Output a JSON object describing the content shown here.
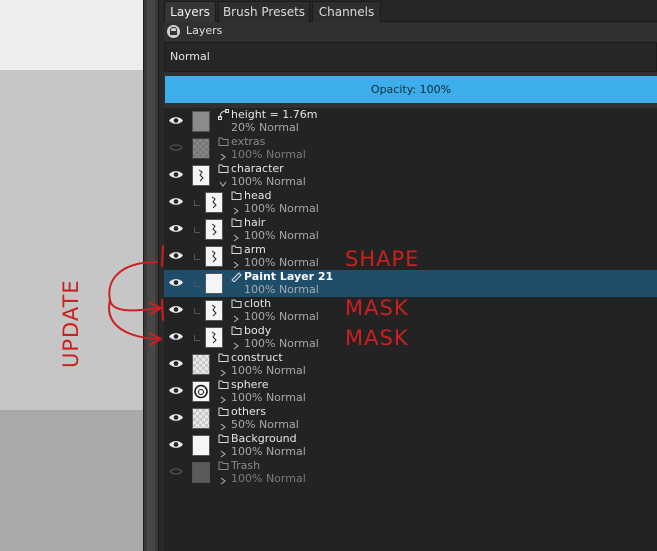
{
  "tabs": [
    {
      "label": "Layers",
      "active": true
    },
    {
      "label": "Brush Presets",
      "active": false
    },
    {
      "label": "Channels",
      "active": false
    }
  ],
  "docker_title": "Layers",
  "blend_mode": "Normal",
  "opacity_label": "Opacity:  100%",
  "accent_color": "#3daee9",
  "selected_row_color": "#1f4e6b",
  "layers": [
    {
      "name": "height = 1.76m",
      "status": "20% Normal",
      "visible": true,
      "type": "vector",
      "depth": 0
    },
    {
      "name": "extras",
      "status": "100% Normal",
      "visible": false,
      "type": "group",
      "depth": 0,
      "collapsed": true
    },
    {
      "name": "character",
      "status": "100% Normal",
      "visible": true,
      "type": "group",
      "depth": 0,
      "collapsed": false
    },
    {
      "name": "head",
      "status": "100% Normal",
      "visible": true,
      "type": "group",
      "depth": 1,
      "collapsed": true
    },
    {
      "name": "hair",
      "status": "100% Normal",
      "visible": true,
      "type": "group",
      "depth": 1,
      "collapsed": true
    },
    {
      "name": "arm",
      "status": "100% Normal",
      "visible": true,
      "type": "group",
      "depth": 1,
      "collapsed": true
    },
    {
      "name": "Paint Layer 21",
      "status": "100% Normal",
      "visible": true,
      "type": "paint",
      "depth": 1,
      "selected": true
    },
    {
      "name": "cloth",
      "status": "100% Normal",
      "visible": true,
      "type": "group",
      "depth": 1,
      "collapsed": true
    },
    {
      "name": "body",
      "status": "100% Normal",
      "visible": true,
      "type": "group",
      "depth": 1,
      "collapsed": true
    },
    {
      "name": "construct",
      "status": "100% Normal",
      "visible": true,
      "type": "group",
      "depth": 0,
      "collapsed": true
    },
    {
      "name": "sphere",
      "status": "100% Normal",
      "visible": true,
      "type": "group",
      "depth": 0,
      "collapsed": true
    },
    {
      "name": "others",
      "status": "50% Normal",
      "visible": true,
      "type": "group",
      "depth": 0,
      "collapsed": true
    },
    {
      "name": "Background",
      "status": "100% Normal",
      "visible": true,
      "type": "group",
      "depth": 0,
      "collapsed": true
    },
    {
      "name": "Trash",
      "status": "100% Normal",
      "visible": false,
      "type": "group",
      "depth": 0,
      "collapsed": true
    }
  ],
  "annotations": {
    "color": "#cc2020",
    "labels": [
      "SHAPE",
      "MASK",
      "MASK",
      "UPDATE"
    ]
  }
}
